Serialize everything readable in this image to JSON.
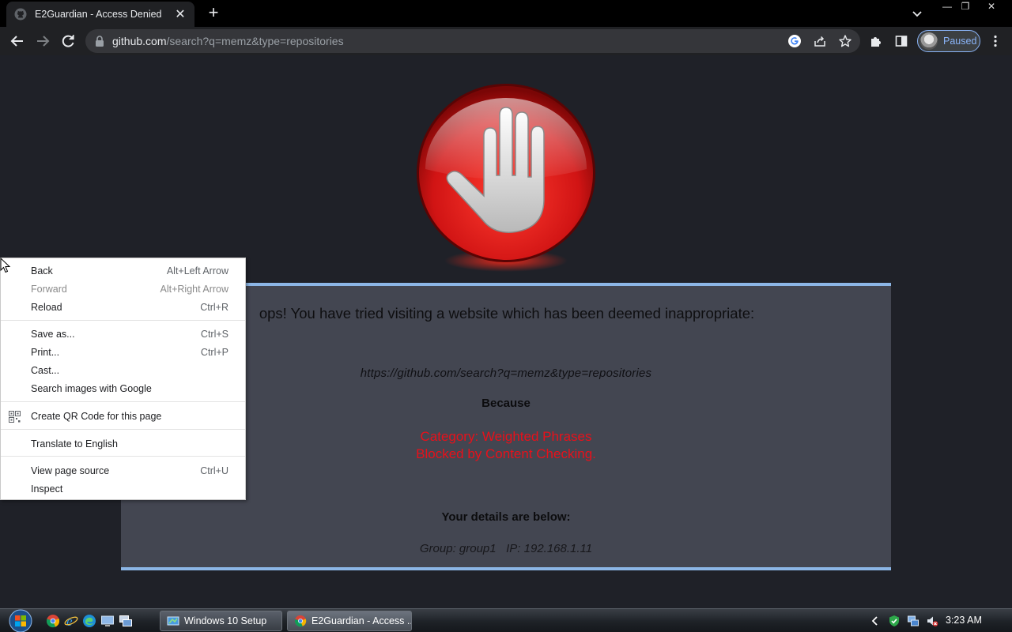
{
  "browser": {
    "tab": {
      "title": "E2Guardian - Access Denied",
      "close": "✕"
    },
    "new_tab": "+",
    "window_controls": {
      "minimize": "—",
      "restore": "❐",
      "close": "✕"
    },
    "address": {
      "host": "github.com",
      "path": "/search?q=memz&type=repositories"
    },
    "profile_label": "Paused"
  },
  "page": {
    "headline": "ops! You have tried visiting a website which has been deemed inappropriate:",
    "blocked_url": "https://github.com/search?q=memz&type=repositories",
    "because": "Because",
    "category_line1": "Category: Weighted Phrases",
    "category_line2": "Blocked by Content Checking.",
    "details_heading": "Your details are below:",
    "group_info": "Group: group1   IP: 192.168.1.11",
    "colors": {
      "background": "#1f2128",
      "box": "#434651",
      "border": "#8cb6e6",
      "alert": "#e8101a"
    }
  },
  "context_menu": {
    "back": {
      "label": "Back",
      "shortcut": "Alt+Left Arrow"
    },
    "forward": {
      "label": "Forward",
      "shortcut": "Alt+Right Arrow"
    },
    "reload": {
      "label": "Reload",
      "shortcut": "Ctrl+R"
    },
    "save_as": {
      "label": "Save as...",
      "shortcut": "Ctrl+S"
    },
    "print": {
      "label": "Print...",
      "shortcut": "Ctrl+P"
    },
    "cast": {
      "label": "Cast..."
    },
    "search_images": {
      "label": "Search images with Google"
    },
    "qr_code": {
      "label": "Create QR Code for this page"
    },
    "translate": {
      "label": "Translate to English"
    },
    "view_source": {
      "label": "View page source",
      "shortcut": "Ctrl+U"
    },
    "inspect": {
      "label": "Inspect"
    }
  },
  "taskbar": {
    "buttons": [
      {
        "label": "Windows 10 Setup"
      },
      {
        "label": "E2Guardian - Access ..."
      }
    ],
    "clock": "3:23 AM"
  }
}
